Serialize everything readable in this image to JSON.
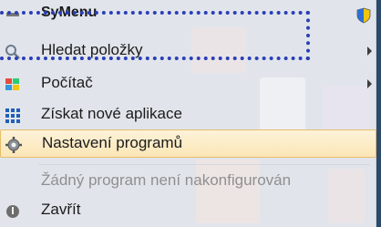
{
  "menu": {
    "title": "SyMenu",
    "items": [
      {
        "label": "Hledat položky",
        "icon": "search-icon",
        "submenu": true
      },
      {
        "label": "Počítač",
        "icon": "windows-logo-icon",
        "submenu": true
      },
      {
        "label": "Získat nové aplikace",
        "icon": "grid-apps-icon",
        "submenu": false
      },
      {
        "label": "Nastavení programů",
        "icon": "gear-icon",
        "submenu": false,
        "selected": true
      },
      {
        "label": "Žádný program není nakonfigurován",
        "icon": "",
        "submenu": false,
        "disabled": true
      },
      {
        "label": "Zavřít",
        "icon": "power-icon",
        "submenu": false
      }
    ]
  },
  "colors": {
    "selection_bg": "#fbe6b6",
    "selection_border": "#e6bd6a",
    "highlight_dots": "#2b3eb8"
  }
}
